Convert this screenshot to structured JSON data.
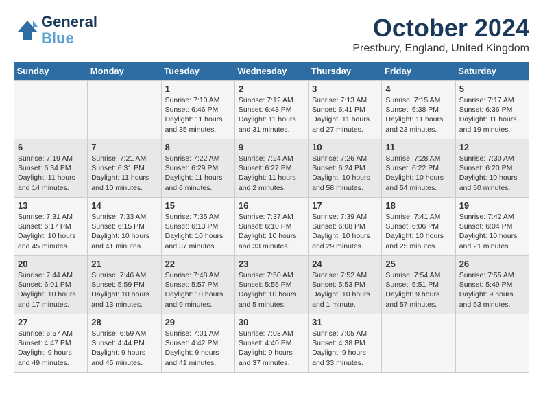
{
  "header": {
    "logo_line1": "General",
    "logo_line2": "Blue",
    "month_title": "October 2024",
    "location": "Prestbury, England, United Kingdom"
  },
  "weekdays": [
    "Sunday",
    "Monday",
    "Tuesday",
    "Wednesday",
    "Thursday",
    "Friday",
    "Saturday"
  ],
  "weeks": [
    [
      {
        "day": "",
        "content": ""
      },
      {
        "day": "",
        "content": ""
      },
      {
        "day": "1",
        "content": "Sunrise: 7:10 AM\nSunset: 6:46 PM\nDaylight: 11 hours and 35 minutes."
      },
      {
        "day": "2",
        "content": "Sunrise: 7:12 AM\nSunset: 6:43 PM\nDaylight: 11 hours and 31 minutes."
      },
      {
        "day": "3",
        "content": "Sunrise: 7:13 AM\nSunset: 6:41 PM\nDaylight: 11 hours and 27 minutes."
      },
      {
        "day": "4",
        "content": "Sunrise: 7:15 AM\nSunset: 6:38 PM\nDaylight: 11 hours and 23 minutes."
      },
      {
        "day": "5",
        "content": "Sunrise: 7:17 AM\nSunset: 6:36 PM\nDaylight: 11 hours and 19 minutes."
      }
    ],
    [
      {
        "day": "6",
        "content": "Sunrise: 7:19 AM\nSunset: 6:34 PM\nDaylight: 11 hours and 14 minutes."
      },
      {
        "day": "7",
        "content": "Sunrise: 7:21 AM\nSunset: 6:31 PM\nDaylight: 11 hours and 10 minutes."
      },
      {
        "day": "8",
        "content": "Sunrise: 7:22 AM\nSunset: 6:29 PM\nDaylight: 11 hours and 6 minutes."
      },
      {
        "day": "9",
        "content": "Sunrise: 7:24 AM\nSunset: 6:27 PM\nDaylight: 11 hours and 2 minutes."
      },
      {
        "day": "10",
        "content": "Sunrise: 7:26 AM\nSunset: 6:24 PM\nDaylight: 10 hours and 58 minutes."
      },
      {
        "day": "11",
        "content": "Sunrise: 7:28 AM\nSunset: 6:22 PM\nDaylight: 10 hours and 54 minutes."
      },
      {
        "day": "12",
        "content": "Sunrise: 7:30 AM\nSunset: 6:20 PM\nDaylight: 10 hours and 50 minutes."
      }
    ],
    [
      {
        "day": "13",
        "content": "Sunrise: 7:31 AM\nSunset: 6:17 PM\nDaylight: 10 hours and 45 minutes."
      },
      {
        "day": "14",
        "content": "Sunrise: 7:33 AM\nSunset: 6:15 PM\nDaylight: 10 hours and 41 minutes."
      },
      {
        "day": "15",
        "content": "Sunrise: 7:35 AM\nSunset: 6:13 PM\nDaylight: 10 hours and 37 minutes."
      },
      {
        "day": "16",
        "content": "Sunrise: 7:37 AM\nSunset: 6:10 PM\nDaylight: 10 hours and 33 minutes."
      },
      {
        "day": "17",
        "content": "Sunrise: 7:39 AM\nSunset: 6:08 PM\nDaylight: 10 hours and 29 minutes."
      },
      {
        "day": "18",
        "content": "Sunrise: 7:41 AM\nSunset: 6:06 PM\nDaylight: 10 hours and 25 minutes."
      },
      {
        "day": "19",
        "content": "Sunrise: 7:42 AM\nSunset: 6:04 PM\nDaylight: 10 hours and 21 minutes."
      }
    ],
    [
      {
        "day": "20",
        "content": "Sunrise: 7:44 AM\nSunset: 6:01 PM\nDaylight: 10 hours and 17 minutes."
      },
      {
        "day": "21",
        "content": "Sunrise: 7:46 AM\nSunset: 5:59 PM\nDaylight: 10 hours and 13 minutes."
      },
      {
        "day": "22",
        "content": "Sunrise: 7:48 AM\nSunset: 5:57 PM\nDaylight: 10 hours and 9 minutes."
      },
      {
        "day": "23",
        "content": "Sunrise: 7:50 AM\nSunset: 5:55 PM\nDaylight: 10 hours and 5 minutes."
      },
      {
        "day": "24",
        "content": "Sunrise: 7:52 AM\nSunset: 5:53 PM\nDaylight: 10 hours and 1 minute."
      },
      {
        "day": "25",
        "content": "Sunrise: 7:54 AM\nSunset: 5:51 PM\nDaylight: 9 hours and 57 minutes."
      },
      {
        "day": "26",
        "content": "Sunrise: 7:55 AM\nSunset: 5:49 PM\nDaylight: 9 hours and 53 minutes."
      }
    ],
    [
      {
        "day": "27",
        "content": "Sunrise: 6:57 AM\nSunset: 4:47 PM\nDaylight: 9 hours and 49 minutes."
      },
      {
        "day": "28",
        "content": "Sunrise: 6:59 AM\nSunset: 4:44 PM\nDaylight: 9 hours and 45 minutes."
      },
      {
        "day": "29",
        "content": "Sunrise: 7:01 AM\nSunset: 4:42 PM\nDaylight: 9 hours and 41 minutes."
      },
      {
        "day": "30",
        "content": "Sunrise: 7:03 AM\nSunset: 4:40 PM\nDaylight: 9 hours and 37 minutes."
      },
      {
        "day": "31",
        "content": "Sunrise: 7:05 AM\nSunset: 4:38 PM\nDaylight: 9 hours and 33 minutes."
      },
      {
        "day": "",
        "content": ""
      },
      {
        "day": "",
        "content": ""
      }
    ]
  ]
}
